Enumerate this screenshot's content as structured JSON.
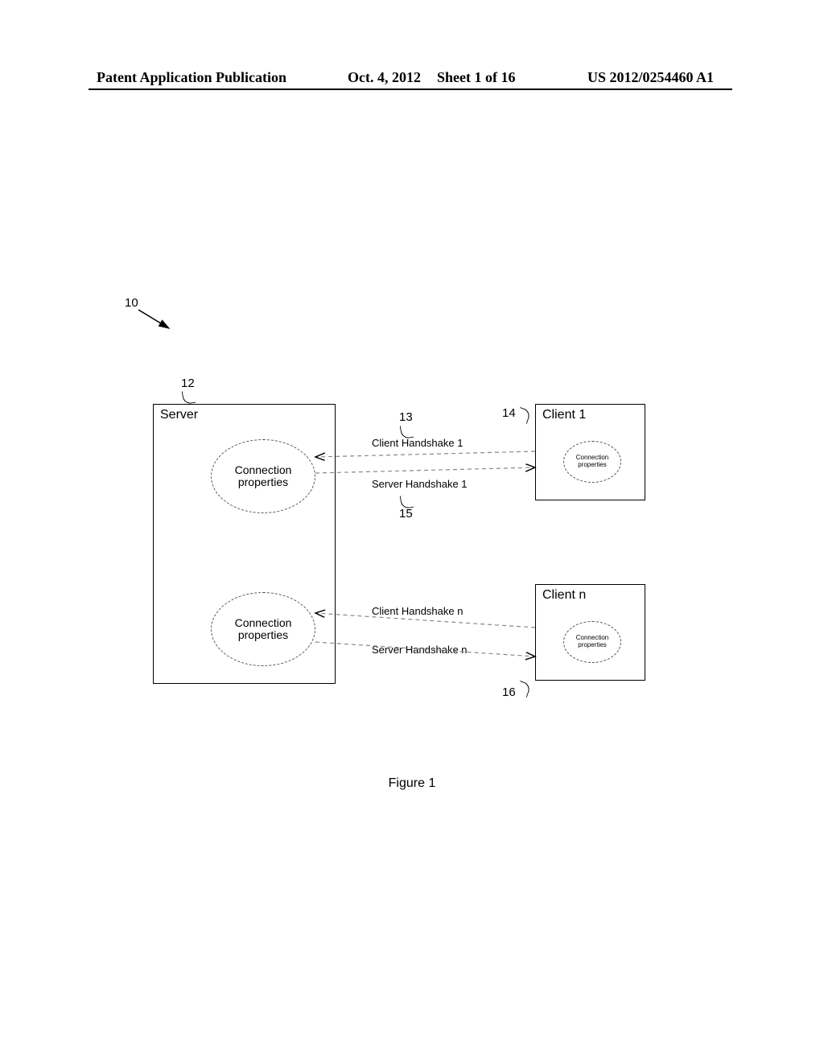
{
  "header": {
    "left": "Patent Application Publication",
    "date": "Oct. 4, 2012",
    "sheet": "Sheet 1 of 16",
    "pubno": "US 2012/0254460 A1"
  },
  "figure": {
    "caption": "Figure 1",
    "ref_system": "10",
    "server": {
      "ref": "12",
      "title": "Server",
      "bubble1": "Connection\nproperties",
      "bubble2": "Connection\nproperties"
    },
    "client1": {
      "ref": "14",
      "title": "Client 1",
      "bubble": "Connection\nproperties"
    },
    "clientn": {
      "ref": "16",
      "title": "Client n",
      "bubble": "Connection\nproperties"
    },
    "links": {
      "ch1_ref": "13",
      "ch1": "Client Handshake 1",
      "sh1_ref": "15",
      "sh1": "Server Handshake 1",
      "chn": "Client Handshake n",
      "shn": "Server Handshake n"
    }
  }
}
